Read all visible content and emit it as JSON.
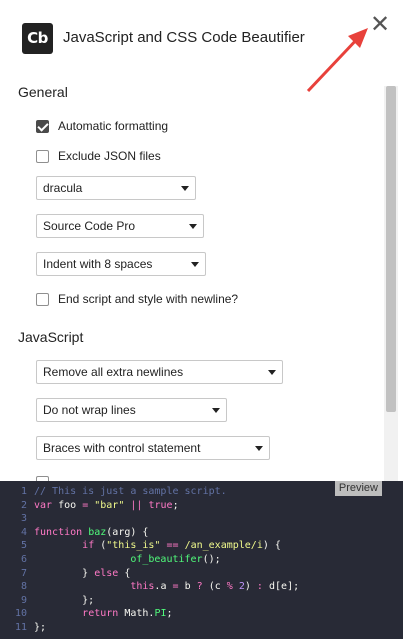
{
  "header": {
    "logo_text": "Cb",
    "title": "JavaScript and CSS Code Beautifier",
    "close_glyph": "✕"
  },
  "general": {
    "title": "General",
    "checkboxes": [
      {
        "label": "Automatic formatting",
        "checked": true
      },
      {
        "label": "Exclude JSON files",
        "checked": false
      }
    ],
    "selects": [
      {
        "value": "dracula"
      },
      {
        "value": "Source Code Pro"
      },
      {
        "value": "Indent with 8 spaces"
      }
    ],
    "newline_checkbox": {
      "label": "End script and style with newline?",
      "checked": false
    }
  },
  "javascript": {
    "title": "JavaScript",
    "selects": [
      {
        "value": "Remove all extra newlines"
      },
      {
        "value": "Do not wrap lines"
      },
      {
        "value": "Braces with control statement"
      }
    ]
  },
  "preview": {
    "label": "Preview",
    "line_numbers": [
      "1",
      "2",
      "3",
      "4",
      "5",
      "6",
      "7",
      "8",
      "9",
      "10",
      "11"
    ],
    "lines": [
      "// This is just a sample script.",
      "var foo = \"bar\" || true;",
      "",
      "function baz(arg) {",
      "        if (\"this_is\" == /an_example/i) {",
      "                of_beautifer();",
      "        } else {",
      "                this.a = b ? (c % 2) : d[e];",
      "        };",
      "        return Math.PI;",
      "};"
    ]
  },
  "colors": {
    "code_bg": "#282a36",
    "comment": "#6272a4",
    "keyword": "#ff79c6",
    "string": "#f1fa8c",
    "function": "#50fa7b",
    "number": "#bd93f9",
    "annotation_arrow": "#e8413b"
  }
}
